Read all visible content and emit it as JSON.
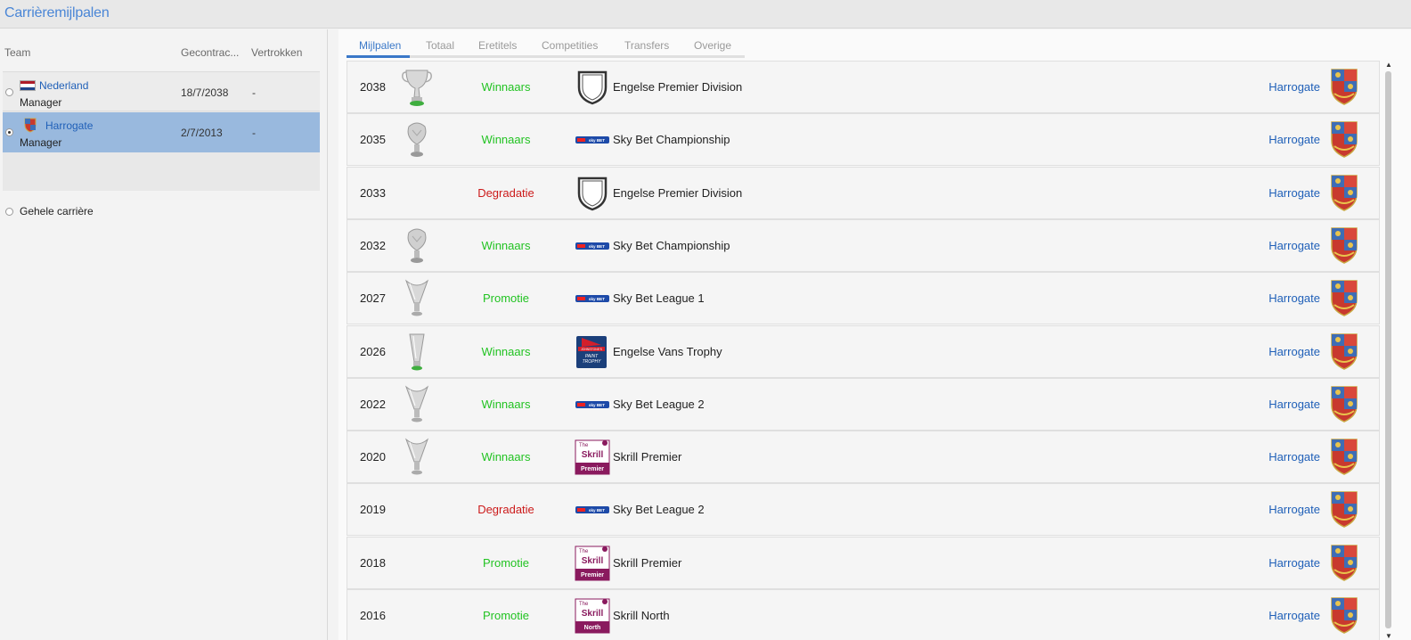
{
  "window": {
    "title": "Carrièremijlpalen"
  },
  "left_panel": {
    "columns": {
      "team": "Team",
      "contract": "Gecontrac...",
      "left": "Vertrokken"
    },
    "teams": [
      {
        "name": "Nederland",
        "role": "Manager",
        "contract": "18/7/2038",
        "left": "-",
        "selected": false
      },
      {
        "name": "Harrogate",
        "role": "Manager",
        "contract": "2/7/2013",
        "left": "-",
        "selected": true
      }
    ],
    "whole_career": "Gehele carrière"
  },
  "tabs": [
    {
      "label": "Mijlpalen",
      "active": true
    },
    {
      "label": "Totaal",
      "active": false
    },
    {
      "label": "Eretitels",
      "active": false
    },
    {
      "label": "Competities",
      "active": false
    },
    {
      "label": "Transfers",
      "active": false
    },
    {
      "label": "Overige",
      "active": false
    }
  ],
  "milestones": [
    {
      "year": "2038",
      "result": "Winnaars",
      "status": "win",
      "trophy": "premier-cup-trophy-icon",
      "competition": "Engelse Premier Division",
      "logo": "shield",
      "club": "Harrogate"
    },
    {
      "year": "2035",
      "result": "Winnaars",
      "status": "win",
      "trophy": "championship-trophy-icon",
      "competition": "Sky Bet Championship",
      "logo": "skybet",
      "club": "Harrogate"
    },
    {
      "year": "2033",
      "result": "Degradatie",
      "status": "relegation",
      "trophy": "",
      "competition": "Engelse Premier Division",
      "logo": "shield",
      "club": "Harrogate"
    },
    {
      "year": "2032",
      "result": "Winnaars",
      "status": "win",
      "trophy": "championship-trophy-icon",
      "competition": "Sky Bet Championship",
      "logo": "skybet",
      "club": "Harrogate"
    },
    {
      "year": "2027",
      "result": "Promotie",
      "status": "promotion",
      "trophy": "league-trophy-icon",
      "competition": "Sky Bet League 1",
      "logo": "skybet",
      "club": "Harrogate"
    },
    {
      "year": "2026",
      "result": "Winnaars",
      "status": "win",
      "trophy": "vase-trophy-icon",
      "competition": "Engelse Vans Trophy",
      "logo": "paint-trophy",
      "club": "Harrogate"
    },
    {
      "year": "2022",
      "result": "Winnaars",
      "status": "win",
      "trophy": "league-trophy-icon",
      "competition": "Sky Bet League 2",
      "logo": "skybet",
      "club": "Harrogate"
    },
    {
      "year": "2020",
      "result": "Winnaars",
      "status": "win",
      "trophy": "league-trophy-icon",
      "competition": "Skrill Premier",
      "logo": "skrill-premier",
      "club": "Harrogate"
    },
    {
      "year": "2019",
      "result": "Degradatie",
      "status": "relegation",
      "trophy": "",
      "competition": "Sky Bet League 2",
      "logo": "skybet",
      "club": "Harrogate"
    },
    {
      "year": "2018",
      "result": "Promotie",
      "status": "promotion",
      "trophy": "",
      "competition": "Skrill Premier",
      "logo": "skrill-premier",
      "club": "Harrogate"
    },
    {
      "year": "2016",
      "result": "Promotie",
      "status": "promotion",
      "trophy": "",
      "competition": "Skrill North",
      "logo": "skrill-north",
      "club": "Harrogate"
    }
  ],
  "logo_text": {
    "skybet": "sky BET",
    "paint_trophy": [
      "JOHNSTONE'S",
      "PAINT",
      "TROPHY"
    ],
    "skrill": [
      "The",
      "Skrill"
    ],
    "skrill_premier_tier": "Premier",
    "skrill_north_tier": "North"
  },
  "colors": {
    "win": "#22c322",
    "promotion": "#22c322",
    "relegation": "#cc1a1a",
    "link": "#2060b8",
    "accent": "#3a78c8"
  }
}
